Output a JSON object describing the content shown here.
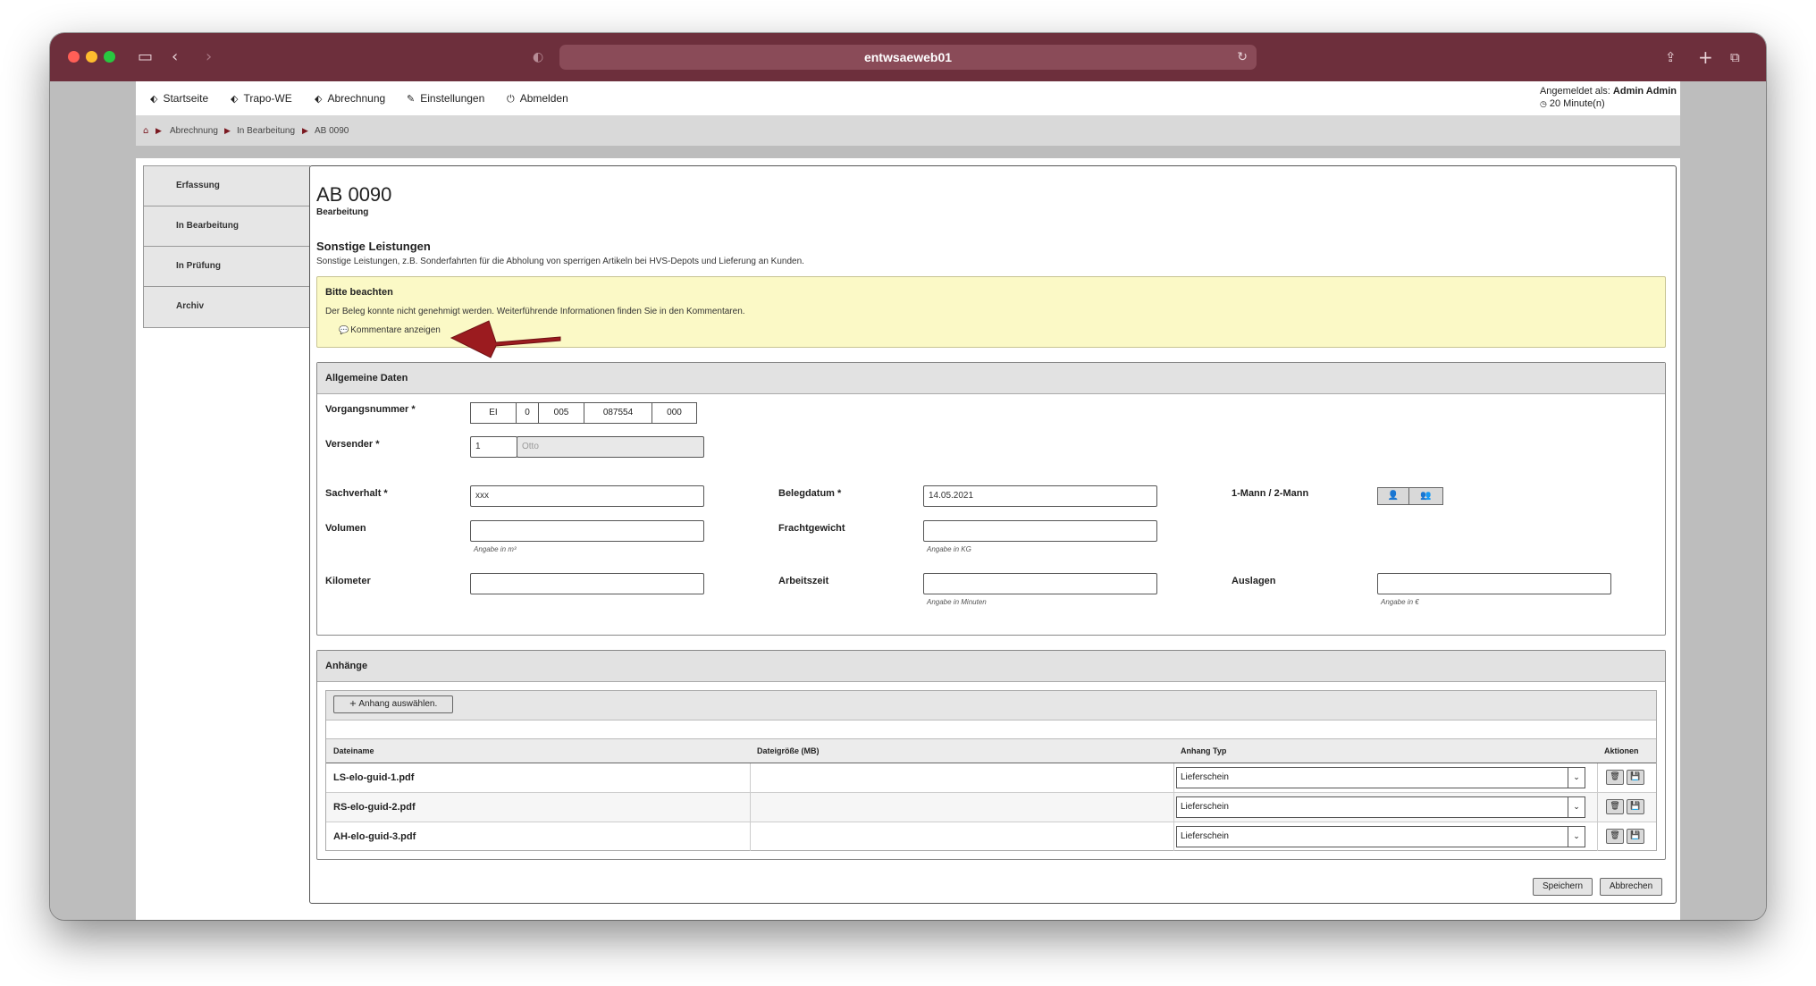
{
  "browser": {
    "url": "entwsaeweb01"
  },
  "nav": {
    "items": [
      {
        "label": "Startseite",
        "icon": "tag-icon"
      },
      {
        "label": "Trapo-WE",
        "icon": "tag-icon"
      },
      {
        "label": "Abrechnung",
        "icon": "tag-icon"
      },
      {
        "label": "Einstellungen",
        "icon": "wrench-icon"
      },
      {
        "label": "Abmelden",
        "icon": "power-icon"
      }
    ],
    "login_label": "Angemeldet als:",
    "login_user": "Admin Admin",
    "session_time": "20 Minute(n)"
  },
  "breadcrumb": [
    "Abrechnung",
    "In Bearbeitung",
    "AB 0090"
  ],
  "sidebar": {
    "items": [
      "Erfassung",
      "In Bearbeitung",
      "In Prüfung",
      "Archiv"
    ]
  },
  "doc": {
    "title": "AB 0090",
    "subtitle": "Bearbeitung",
    "section_title": "Sonstige Leistungen",
    "section_desc": "Sonstige Leistungen, z.B. Sonderfahrten für die Abholung von sperrigen Artikeln bei HVS-Depots und Lieferung an Kunden."
  },
  "notice": {
    "title": "Bitte beachten",
    "text": "Der Beleg konnte nicht genehmigt werden. Weiterführende Informationen finden Sie in den Kommentaren.",
    "link": "Kommentare anzeigen"
  },
  "general": {
    "heading": "Allgemeine Daten",
    "vorgang_label": "Vorgangsnummer *",
    "vorgang": [
      "EI",
      "0",
      "005",
      "087554",
      "000"
    ],
    "versender_label": "Versender *",
    "versender_id": "1",
    "versender_name": "Otto",
    "sachverhalt_label": "Sachverhalt *",
    "sachverhalt": "xxx",
    "belegdatum_label": "Belegdatum *",
    "belegdatum": "14.05.2021",
    "mann_label": "1-Mann / 2-Mann",
    "volumen_label": "Volumen",
    "volumen_hint": "Angabe in m³",
    "fracht_label": "Frachtgewicht",
    "fracht_hint": "Angabe in KG",
    "km_label": "Kilometer",
    "arbeitszeit_label": "Arbeitszeit",
    "arbeitszeit_hint": "Angabe in Minuten",
    "auslagen_label": "Auslagen",
    "auslagen_hint": "Angabe in €"
  },
  "attachments": {
    "heading": "Anhänge",
    "add_button": "Anhang auswählen.",
    "columns": [
      "Dateiname",
      "Dateigröße (MB)",
      "Anhang Typ",
      "Aktionen"
    ],
    "rows": [
      {
        "name": "LS-elo-guid-1.pdf",
        "size": "",
        "type": "Lieferschein"
      },
      {
        "name": "RS-elo-guid-2.pdf",
        "size": "",
        "type": "Lieferschein"
      },
      {
        "name": "AH-elo-guid-3.pdf",
        "size": "",
        "type": "Lieferschein"
      }
    ]
  },
  "actions": {
    "save": "Speichern",
    "cancel": "Abbrechen"
  },
  "colors": {
    "titlebar": "#6d2f3c",
    "notice_bg": "#fbf9c6",
    "arrow": "#9b1b1f"
  }
}
